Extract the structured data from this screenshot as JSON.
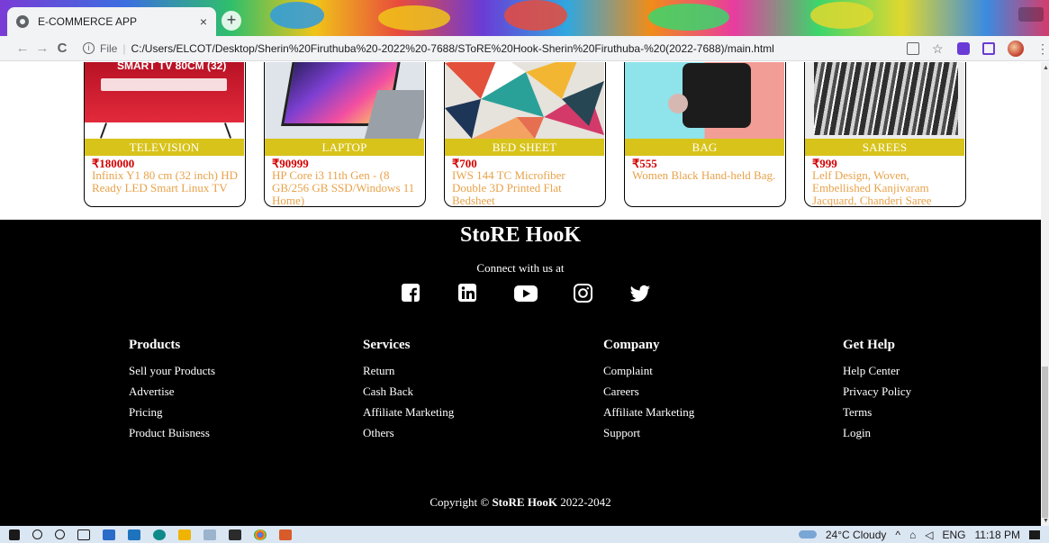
{
  "browser": {
    "tab_title": "E-COMMERCE APP",
    "tab_close": "×",
    "new_tab": "+",
    "address_protocol": "File",
    "address_url": "C:/Users/ELCOT/Desktop/Sherin%20Firuthuba%20-2022%20-7688/SToRE%20Hook-Sherin%20Firuthuba-%20(2022-7688)/main.html",
    "back": "←",
    "forward": "→",
    "reload": "C",
    "info": "i",
    "star": "☆",
    "menu": "⋮"
  },
  "products": [
    {
      "category": "TELEVISION",
      "price": "₹180000",
      "title": "Infinix Y1 80 cm (32 inch) HD Ready LED Smart Linux TV",
      "image_text": "SMART TV 80CM (32)"
    },
    {
      "category": "LAPTOP",
      "price": "₹90999",
      "title": "HP Core i3 11th Gen - (8 GB/256 GB SSD/Windows 11 Home)"
    },
    {
      "category": "BED SHEET",
      "price": "₹700",
      "title": "IWS 144 TC Microfiber Double 3D Printed Flat Bedsheet"
    },
    {
      "category": "BAG",
      "price": "₹555",
      "title": "Women Black Hand-held Bag."
    },
    {
      "category": "SAREES",
      "price": "₹999",
      "title": "Lelf Design, Woven, Embellished Kanjivaram Jacquard, Chanderi Saree"
    }
  ],
  "footer": {
    "brand": "StoRE HooK",
    "connect": "Connect with us at",
    "social_icons": [
      "facebook-icon",
      "linkedin-icon",
      "youtube-icon",
      "instagram-icon",
      "twitter-icon"
    ],
    "columns": [
      {
        "heading": "Products",
        "links": [
          "Sell your Products",
          "Advertise",
          "Pricing",
          "Product Buisness"
        ]
      },
      {
        "heading": "Services",
        "links": [
          "Return",
          "Cash Back",
          "Affiliate Marketing",
          "Others"
        ]
      },
      {
        "heading": "Company",
        "links": [
          "Complaint",
          "Careers",
          "Affiliate Marketing",
          "Support"
        ]
      },
      {
        "heading": "Get Help",
        "links": [
          "Help Center",
          "Privacy Policy",
          "Terms",
          "Login"
        ]
      }
    ],
    "copyright_prefix": "Copyright ©",
    "copyright_brand": "StoRE HooK",
    "copyright_years": "2022-2042"
  },
  "taskbar": {
    "weather": "24°C  Cloudy",
    "lang": "ENG",
    "time": "11:18 PM"
  },
  "colors": {
    "category_band": "#d8c31a",
    "price": "#d40000",
    "title": "#e8a24a",
    "footer_bg": "#000000"
  }
}
